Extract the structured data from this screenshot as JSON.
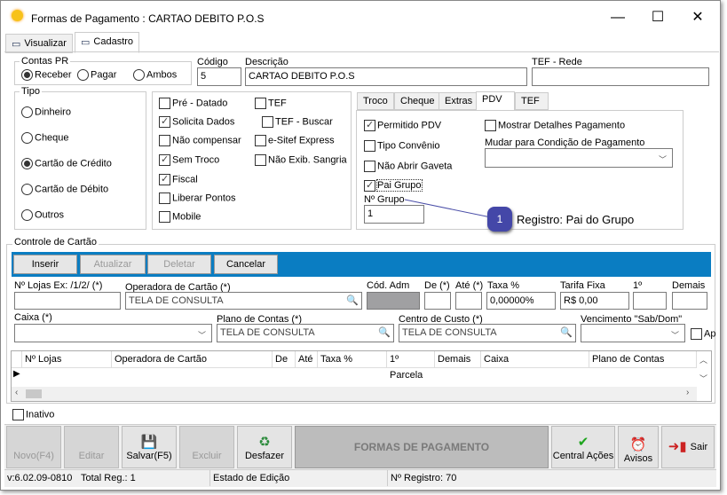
{
  "window": {
    "title": "Formas de Pagamento  : CARTAO DEBITO P.O.S",
    "minimize": "—",
    "maximize": "☐",
    "close": "✕"
  },
  "tabs": [
    {
      "label": "Visualizar"
    },
    {
      "label": "Cadastro"
    }
  ],
  "contas_pr": {
    "legend": "Contas PR",
    "options": [
      "Receber",
      "Pagar",
      "Ambos"
    ],
    "selected": "Receber"
  },
  "codigo": {
    "label": "Código",
    "value": "5"
  },
  "descricao": {
    "label": "Descrição",
    "value": "CARTAO DEBITO P.O.S"
  },
  "tef_rede": {
    "label": "TEF - Rede",
    "value": ""
  },
  "tipo": {
    "legend": "Tipo",
    "options": [
      "Dinheiro",
      "Cheque",
      "Cartão de Crédito",
      "Cartão de Débito",
      "Outros"
    ],
    "selected": "Cartão de Crédito"
  },
  "flags_left": [
    {
      "label": "Pré - Datado",
      "checked": false
    },
    {
      "label": "Solicita Dados",
      "checked": true
    },
    {
      "label": "Não compensar",
      "checked": false
    },
    {
      "label": "Sem Troco",
      "checked": true
    },
    {
      "label": "Fiscal",
      "checked": true
    },
    {
      "label": "Liberar Pontos",
      "checked": false
    },
    {
      "label": "Mobile",
      "checked": false
    }
  ],
  "flags_right": [
    {
      "label": "TEF",
      "checked": false
    },
    {
      "label": "TEF - Buscar",
      "checked": false
    },
    {
      "label": "e-Sitef Express",
      "checked": false
    },
    {
      "label": "Não Exib. Sangria",
      "checked": false
    }
  ],
  "subtabs": [
    {
      "label": "Troco"
    },
    {
      "label": "Cheque"
    },
    {
      "label": "Extras"
    },
    {
      "label": "PDV"
    },
    {
      "label": "TEF"
    }
  ],
  "pdv": {
    "checks": [
      {
        "label": "Permitido PDV",
        "checked": true
      },
      {
        "label": "Tipo Convênio",
        "checked": false
      },
      {
        "label": "Não Abrir Gaveta",
        "checked": false
      },
      {
        "label": "Pai Grupo",
        "checked": true
      }
    ],
    "mostrar": {
      "label": "Mostrar Detalhes Pagamento",
      "checked": false
    },
    "mudar_label": "Mudar para Condição de Pagamento",
    "grupo_label": "Nº Grupo",
    "grupo_value": "1"
  },
  "callout": {
    "number": "1",
    "text": "Registro: Pai do Grupo"
  },
  "controle": {
    "legend": "Controle de Cartão",
    "buttons": [
      "Inserir",
      "Atualizar",
      "Deletar",
      "Cancelar"
    ],
    "labels": {
      "lojas": "Nº Lojas Ex: /1/2/ (*)",
      "operadora": "Operadora de Cartão (*)",
      "cod_adm": "Cód. Adm",
      "de": "De (*)",
      "ate": "Até (*)",
      "taxa": "Taxa %",
      "tarifa": "Tarifa Fixa",
      "primeiro": "1º",
      "demais": "Demais",
      "caixa": "Caixa (*)",
      "plano": "Plano de Contas (*)",
      "centro": "Centro de Custo (*)",
      "vencimento": "Vencimento \"Sab/Dom\"",
      "ap": "Ap"
    },
    "values": {
      "operadora": "TELA DE CONSULTA",
      "taxa": "0,00000%",
      "tarifa": "R$ 0,00",
      "plano": "TELA DE CONSULTA",
      "centro": "TELA DE CONSULTA"
    }
  },
  "grid": {
    "columns": [
      "Nº Lojas",
      "Operadora de Cartão",
      "De",
      "Até",
      "Taxa %",
      "1º Parcela",
      "Demais",
      "Caixa",
      "Plano de Contas"
    ]
  },
  "inativo": {
    "label": "Inativo",
    "checked": false
  },
  "toolbar": {
    "novo": "Novo(F4)",
    "editar": "Editar",
    "salvar": "Salvar(F5)",
    "excluir": "Excluir",
    "desfazer": "Desfazer",
    "title": "FORMAS DE PAGAMENTO",
    "central": "Central Ações",
    "avisos": "Avisos",
    "sair": "Sair"
  },
  "status": {
    "version": "v:6.02.09-0810",
    "total": "Total Reg.: 1",
    "estado": "Estado de Edição",
    "registro": "Nº Registro: 70"
  }
}
